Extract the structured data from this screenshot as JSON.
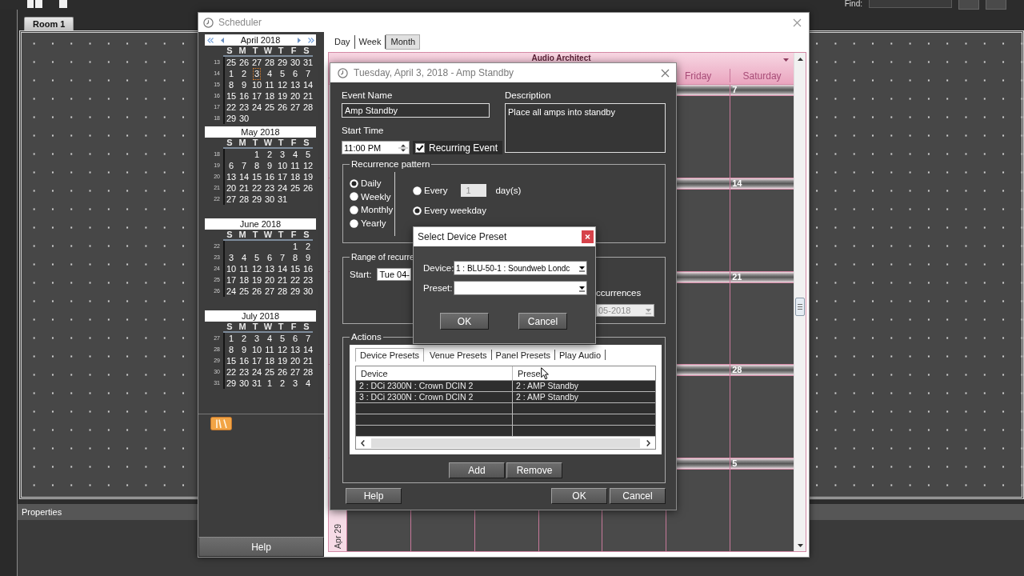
{
  "app": {
    "find_label": "Find:",
    "document_tabs": [
      {
        "label": "Room 1",
        "selected": true
      }
    ],
    "properties_title": "Properties"
  },
  "scheduler": {
    "title": "Scheduler",
    "calendars": [
      {
        "title": "April 2018",
        "nav_arrows": true,
        "weekdays": [
          "S",
          "M",
          "T",
          "W",
          "T",
          "F",
          "S"
        ],
        "weeks": [
          {
            "number": "13",
            "days": [
              {
                "day": "25",
                "selected": false
              },
              {
                "day": "26",
                "selected": false
              },
              {
                "day": "27",
                "selected": false
              },
              {
                "day": "28",
                "selected": false
              },
              {
                "day": "29",
                "selected": false
              },
              {
                "day": "30",
                "selected": false
              },
              {
                "day": "31",
                "selected": false
              }
            ]
          },
          {
            "number": "14",
            "days": [
              {
                "day": "1",
                "selected": false
              },
              {
                "day": "2",
                "selected": false
              },
              {
                "day": "3",
                "selected": true
              },
              {
                "day": "4",
                "selected": false
              },
              {
                "day": "5",
                "selected": false
              },
              {
                "day": "6",
                "selected": false
              },
              {
                "day": "7",
                "selected": false
              }
            ]
          },
          {
            "number": "15",
            "days": [
              {
                "day": "8",
                "selected": false
              },
              {
                "day": "9",
                "selected": false
              },
              {
                "day": "10",
                "selected": false
              },
              {
                "day": "11",
                "selected": false
              },
              {
                "day": "12",
                "selected": false
              },
              {
                "day": "13",
                "selected": false
              },
              {
                "day": "14",
                "selected": false
              }
            ]
          },
          {
            "number": "16",
            "days": [
              {
                "day": "15",
                "selected": false
              },
              {
                "day": "16",
                "selected": false
              },
              {
                "day": "17",
                "selected": false
              },
              {
                "day": "18",
                "selected": false
              },
              {
                "day": "19",
                "selected": false
              },
              {
                "day": "20",
                "selected": false
              },
              {
                "day": "21",
                "selected": false
              }
            ]
          },
          {
            "number": "17",
            "days": [
              {
                "day": "22",
                "selected": false
              },
              {
                "day": "23",
                "selected": false
              },
              {
                "day": "24",
                "selected": false
              },
              {
                "day": "25",
                "selected": false
              },
              {
                "day": "26",
                "selected": false
              },
              {
                "day": "27",
                "selected": false
              },
              {
                "day": "28",
                "selected": false
              }
            ]
          },
          {
            "number": "18",
            "days": [
              {
                "day": "29",
                "selected": false
              },
              {
                "day": "30",
                "selected": false
              }
            ]
          }
        ]
      },
      {
        "title": "May 2018",
        "nav_arrows": false,
        "weekdays": [
          "S",
          "M",
          "T",
          "W",
          "T",
          "F",
          "S"
        ],
        "weeks": [
          {
            "number": "18",
            "days": [
              {
                "day": "1",
                "selected": false
              },
              {
                "day": "2",
                "selected": false
              },
              {
                "day": "3",
                "selected": false
              },
              {
                "day": "4",
                "selected": false
              },
              {
                "day": "5",
                "selected": false
              }
            ]
          },
          {
            "number": "19",
            "days": [
              {
                "day": "6",
                "selected": false
              },
              {
                "day": "7",
                "selected": false
              },
              {
                "day": "8",
                "selected": false
              },
              {
                "day": "9",
                "selected": false
              },
              {
                "day": "10",
                "selected": false
              },
              {
                "day": "11",
                "selected": false
              },
              {
                "day": "12",
                "selected": false
              }
            ]
          },
          {
            "number": "20",
            "days": [
              {
                "day": "13",
                "selected": false
              },
              {
                "day": "14",
                "selected": false
              },
              {
                "day": "15",
                "selected": false
              },
              {
                "day": "16",
                "selected": false
              },
              {
                "day": "17",
                "selected": false
              },
              {
                "day": "18",
                "selected": false
              },
              {
                "day": "19",
                "selected": false
              }
            ]
          },
          {
            "number": "21",
            "days": [
              {
                "day": "20",
                "selected": false
              },
              {
                "day": "21",
                "selected": false
              },
              {
                "day": "22",
                "selected": false
              },
              {
                "day": "23",
                "selected": false
              },
              {
                "day": "24",
                "selected": false
              },
              {
                "day": "25",
                "selected": false
              },
              {
                "day": "26",
                "selected": false
              }
            ]
          },
          {
            "number": "22",
            "days": [
              {
                "day": "27",
                "selected": false
              },
              {
                "day": "28",
                "selected": false
              },
              {
                "day": "29",
                "selected": false
              },
              {
                "day": "30",
                "selected": false
              },
              {
                "day": "31",
                "selected": false
              }
            ]
          }
        ]
      },
      {
        "title": "June 2018",
        "nav_arrows": false,
        "weekdays": [
          "S",
          "M",
          "T",
          "W",
          "T",
          "F",
          "S"
        ],
        "weeks": [
          {
            "number": "22",
            "days": [
              {
                "day": "1",
                "selected": false
              },
              {
                "day": "2",
                "selected": false
              }
            ]
          },
          {
            "number": "23",
            "days": [
              {
                "day": "3",
                "selected": false
              },
              {
                "day": "4",
                "selected": false
              },
              {
                "day": "5",
                "selected": false
              },
              {
                "day": "6",
                "selected": false
              },
              {
                "day": "7",
                "selected": false
              },
              {
                "day": "8",
                "selected": false
              },
              {
                "day": "9",
                "selected": false
              }
            ]
          },
          {
            "number": "24",
            "days": [
              {
                "day": "10",
                "selected": false
              },
              {
                "day": "11",
                "selected": false
              },
              {
                "day": "12",
                "selected": false
              },
              {
                "day": "13",
                "selected": false
              },
              {
                "day": "14",
                "selected": false
              },
              {
                "day": "15",
                "selected": false
              },
              {
                "day": "16",
                "selected": false
              }
            ]
          },
          {
            "number": "25",
            "days": [
              {
                "day": "17",
                "selected": false
              },
              {
                "day": "18",
                "selected": false
              },
              {
                "day": "19",
                "selected": false
              },
              {
                "day": "20",
                "selected": false
              },
              {
                "day": "21",
                "selected": false
              },
              {
                "day": "22",
                "selected": false
              },
              {
                "day": "23",
                "selected": false
              }
            ]
          },
          {
            "number": "26",
            "days": [
              {
                "day": "24",
                "selected": false
              },
              {
                "day": "25",
                "selected": false
              },
              {
                "day": "26",
                "selected": false
              },
              {
                "day": "27",
                "selected": false
              },
              {
                "day": "28",
                "selected": false
              },
              {
                "day": "29",
                "selected": false
              },
              {
                "day": "30",
                "selected": false
              }
            ]
          }
        ]
      },
      {
        "title": "July 2018",
        "nav_arrows": false,
        "weekdays": [
          "S",
          "M",
          "T",
          "W",
          "T",
          "F",
          "S"
        ],
        "weeks": [
          {
            "number": "27",
            "days": [
              {
                "day": "1",
                "selected": false
              },
              {
                "day": "2",
                "selected": false
              },
              {
                "day": "3",
                "selected": false
              },
              {
                "day": "4",
                "selected": false
              },
              {
                "day": "5",
                "selected": false
              },
              {
                "day": "6",
                "selected": false
              },
              {
                "day": "7",
                "selected": false
              }
            ]
          },
          {
            "number": "28",
            "days": [
              {
                "day": "8",
                "selected": false
              },
              {
                "day": "9",
                "selected": false
              },
              {
                "day": "10",
                "selected": false
              },
              {
                "day": "11",
                "selected": false
              },
              {
                "day": "12",
                "selected": false
              },
              {
                "day": "13",
                "selected": false
              },
              {
                "day": "14",
                "selected": false
              }
            ]
          },
          {
            "number": "29",
            "days": [
              {
                "day": "15",
                "selected": false
              },
              {
                "day": "16",
                "selected": false
              },
              {
                "day": "17",
                "selected": false
              },
              {
                "day": "18",
                "selected": false
              },
              {
                "day": "19",
                "selected": false
              },
              {
                "day": "20",
                "selected": false
              },
              {
                "day": "21",
                "selected": false
              }
            ]
          },
          {
            "number": "30",
            "days": [
              {
                "day": "22",
                "selected": false
              },
              {
                "day": "23",
                "selected": false
              },
              {
                "day": "24",
                "selected": false
              },
              {
                "day": "25",
                "selected": false
              },
              {
                "day": "26",
                "selected": false
              },
              {
                "day": "27",
                "selected": false
              },
              {
                "day": "28",
                "selected": false
              }
            ]
          },
          {
            "number": "31",
            "days": [
              {
                "day": "29",
                "selected": false
              },
              {
                "day": "30",
                "selected": false
              },
              {
                "day": "31",
                "selected": false
              },
              {
                "day": "1",
                "selected": false
              },
              {
                "day": "2",
                "selected": false
              },
              {
                "day": "3",
                "selected": false
              },
              {
                "day": "4",
                "selected": false
              }
            ]
          }
        ]
      }
    ],
    "help_button": "Help",
    "view_tabs": [
      {
        "label": "Day",
        "selected": false
      },
      {
        "label": "Week",
        "selected": false
      },
      {
        "label": "Month",
        "selected": true
      }
    ],
    "month_view": {
      "title": "Audio Architect",
      "day_headers": [
        "Friday",
        "Saturday"
      ],
      "weeks": [
        {
          "saturday": "7"
        },
        {
          "saturday": "14"
        },
        {
          "saturday": "21"
        },
        {
          "saturday": "28"
        },
        {
          "saturday": "5",
          "label": "Apr 29"
        }
      ]
    }
  },
  "event_dialog": {
    "title": "Tuesday, April 3, 2018 - Amp Standby",
    "event_name": {
      "label": "Event Name",
      "value": "Amp Standby"
    },
    "description": {
      "label": "Description",
      "value": "Place all amps into standby"
    },
    "start_time": {
      "label": "Start Time",
      "value": "11:00 PM"
    },
    "recurring_event": {
      "label": "Recurring Event",
      "checked": true
    },
    "recurrence_pattern": {
      "title": "Recurrence pattern",
      "frequencies": [
        {
          "label": "Daily",
          "selected": true
        },
        {
          "label": "Weekly",
          "selected": false
        },
        {
          "label": "Monthly",
          "selected": false
        },
        {
          "label": "Yearly",
          "selected": false
        }
      ],
      "daily_options": [
        {
          "kind": "interval",
          "label": "Every",
          "value": "1",
          "unit": "day(s)",
          "disabled": true,
          "selected": false
        },
        {
          "kind": "simple",
          "label": "Every weekday",
          "selected": true
        }
      ]
    },
    "range_of_recurrence": {
      "title": "Range of recurre",
      "start_label": "Start:",
      "start_value": "Tue 04-",
      "occurrences_label": "ccurrences",
      "end_date": {
        "value": "05-2018",
        "disabled": true
      }
    },
    "actions": {
      "title": "Actions",
      "tabs": [
        {
          "label": "Device Presets",
          "selected": true
        },
        {
          "label": "Venue Presets",
          "selected": false
        },
        {
          "label": "Panel Presets",
          "selected": false
        },
        {
          "label": "Play Audio",
          "selected": false
        }
      ],
      "table": {
        "columns": [
          "Device",
          "Prese"
        ],
        "rows": [
          [
            "2 : DCi 2300N : Crown DCIN 2",
            "2 : AMP Standby"
          ],
          [
            "3 : DCi 2300N : Crown DCIN 2",
            "2 : AMP Standby"
          ]
        ]
      },
      "buttons": [
        "Add",
        "Remove"
      ]
    },
    "buttons": [
      "Help",
      "OK",
      "Cancel"
    ]
  },
  "preset_dialog": {
    "title": "Select Device Preset",
    "device": {
      "label": "Device:",
      "value": "1 : BLU-50-1 : Soundweb Londc"
    },
    "preset": {
      "label": "Preset:"
    },
    "buttons": [
      "OK",
      "Cancel"
    ]
  }
}
